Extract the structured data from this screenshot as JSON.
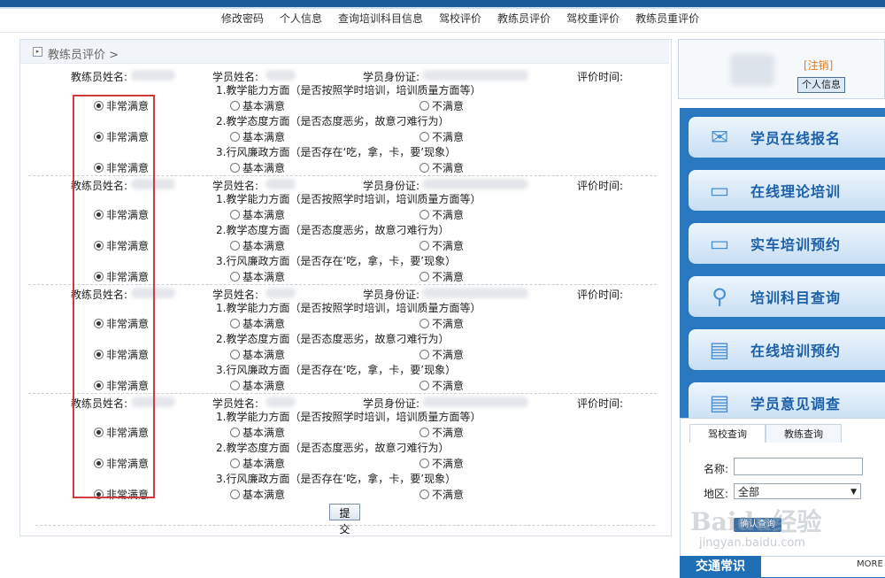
{
  "nav": [
    "修改密码",
    "个人信息",
    "查询培训科目信息",
    "驾校评价",
    "教练员评价",
    "驾校重评价",
    "教练员重评价"
  ],
  "breadcrumb": {
    "icon": "▸",
    "text": "教练员评价 >"
  },
  "labels": {
    "coach_name": "教练员姓名:",
    "student_name": "学员姓名:",
    "student_id": "学员身份证:",
    "eval_time": "评价时间:",
    "q1": "1.教学能力方面（是否按照学时培训，培训质量方面等）",
    "q2": "2.教学态度方面（是否态度恶劣，故意刁难行为）",
    "q3": "3.行风廉政方面（是否存在‘吃，拿，卡，要’现象）",
    "opt_very": "非常满意",
    "opt_basic": "基本满意",
    "opt_not": "不满意"
  },
  "evaluations": [
    {
      "selections": [
        "very",
        "very",
        "very"
      ]
    },
    {
      "selections": [
        "very",
        "very",
        "very"
      ]
    },
    {
      "selections": [
        "very",
        "very",
        "very"
      ]
    },
    {
      "selections": [
        "very",
        "very",
        "very"
      ]
    }
  ],
  "submit_label": "提交",
  "user_panel": {
    "logout": "[注销]",
    "info_button": "个人信息"
  },
  "sidebar": [
    {
      "label": "学员在线报名",
      "icon": "envelope-icon",
      "glyph": "✉"
    },
    {
      "label": "在线理论培训",
      "icon": "computer-icon",
      "glyph": "▭"
    },
    {
      "label": "实车培训预约",
      "icon": "computer-icon",
      "glyph": "▭"
    },
    {
      "label": "培训科目查询",
      "icon": "magnifier-icon",
      "glyph": "⚲"
    },
    {
      "label": "在线培训预约",
      "icon": "document-icon",
      "glyph": "▤"
    },
    {
      "label": "学员意见调查",
      "icon": "document-icon",
      "glyph": "▤"
    }
  ],
  "search": {
    "tabs": [
      "驾校查询",
      "教练查询"
    ],
    "name_label": "名称:",
    "region_label": "地区:",
    "region_value": "全部",
    "submit": "确认查询"
  },
  "watermark": {
    "logo": "Baidu经验",
    "url": "jingyan.baidu.com"
  },
  "footer": {
    "traffic": "交通常识",
    "more": "MORE"
  }
}
